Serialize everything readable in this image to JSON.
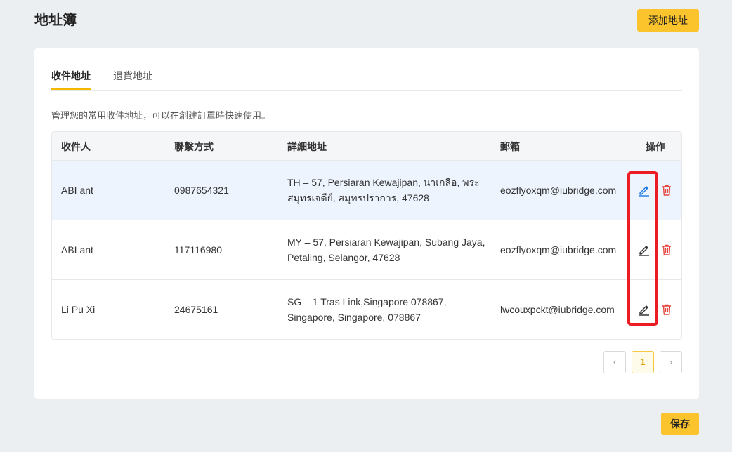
{
  "header": {
    "title": "地址簿",
    "add_label": "添加地址"
  },
  "tabs": [
    {
      "label": "收件地址",
      "active": true
    },
    {
      "label": "退貨地址",
      "active": false
    }
  ],
  "description": "管理您的常用收件地址，可以在創建訂單時快速使用。",
  "table": {
    "columns": [
      "收件人",
      "聯繫方式",
      "詳細地址",
      "郵箱",
      "操作"
    ],
    "rows": [
      {
        "name": "ABI ant",
        "phone": "0987654321",
        "address": "TH – 57, Persiaran Kewajipan, นาเกลือ, พระสมุทรเจดีย์, สมุทรปราการ, 47628",
        "email": "eozflyoxqm@iubridge.com"
      },
      {
        "name": "ABI ant",
        "phone": "117116980",
        "address": "MY – 57, Persiaran Kewajipan, Subang Jaya, Petaling, Selangor, 47628",
        "email": "eozflyoxqm@iubridge.com"
      },
      {
        "name": "Li Pu Xi",
        "phone": "24675161",
        "address": "SG – 1 Tras Link,Singapore 078867, Singapore, Singapore, 078867",
        "email": "lwcouxpckt@iubridge.com"
      }
    ]
  },
  "pagination": {
    "prev": "‹",
    "current": "1",
    "next": "›"
  },
  "footer": {
    "save_label": "保存"
  },
  "colors": {
    "accent": "#fbc42c",
    "edit_active": "#1f7ae0",
    "delete": "#e8453c",
    "annotation": "#ec1c24"
  },
  "icons": {
    "edit": "edit-icon",
    "delete": "trash-icon"
  }
}
